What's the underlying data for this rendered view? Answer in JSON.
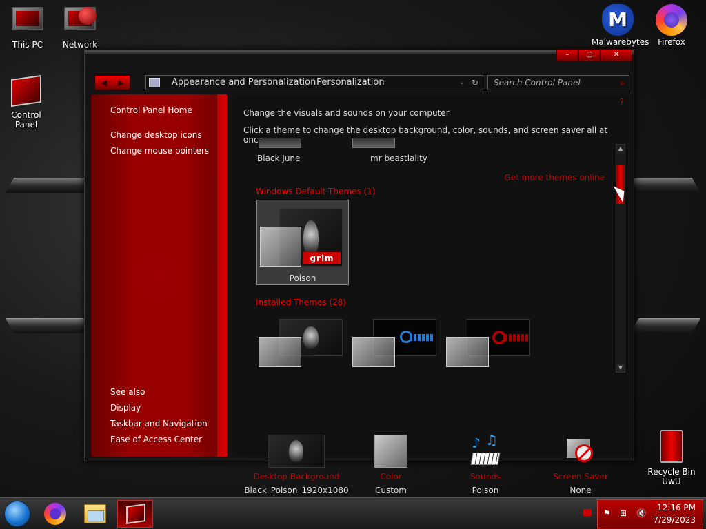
{
  "desktop": {
    "icons": [
      {
        "label": "This PC"
      },
      {
        "label": "Network"
      },
      {
        "label": "Control Panel"
      },
      {
        "label": "Malwarebytes"
      },
      {
        "label": "Firefox"
      },
      {
        "label": "Recycle Bin\nUwU"
      }
    ]
  },
  "window": {
    "caption": {
      "minimize": "–",
      "maximize": "□",
      "close": "✕"
    },
    "nav": {
      "back": "◀",
      "forward": "▶"
    },
    "address": {
      "crumbs": [
        "Appearance and Personalization",
        "Personalization"
      ],
      "dropdown": "⌄",
      "refresh": "↻"
    },
    "search": {
      "placeholder": "Search Control Panel",
      "icon": "⌕"
    },
    "sidebar": {
      "home": "Control Panel Home",
      "links": [
        "Change desktop icons",
        "Change mouse pointers"
      ],
      "see_also_header": "See also",
      "see_also": [
        "Display",
        "Taskbar and Navigation",
        "Ease of Access Center"
      ]
    },
    "content": {
      "title": "Change the visuals and sounds on your computer",
      "subtitle": "Click a theme to change the desktop background, color, sounds, and screen saver all at once.",
      "help": "?",
      "partial_themes": [
        "Black June",
        "mr beastiality"
      ],
      "get_more": "Get more themes online",
      "default_group": "Windows Default Themes (1)",
      "default_theme": {
        "name": "Poison",
        "badge": "grim",
        "selected": true
      },
      "installed_group": "Installed Themes (28)",
      "installed_thumbs": [
        "skull",
        "blue",
        "red"
      ],
      "bottom": [
        {
          "label": "Desktop Background",
          "value": "Black_Poison_1920x1080"
        },
        {
          "label": "Color",
          "value": "Custom"
        },
        {
          "label": "Sounds",
          "value": "Poison"
        },
        {
          "label": "Screen Saver",
          "value": "None"
        }
      ]
    },
    "scrollbar": {
      "position_fraction": 0.1
    }
  },
  "taskbar": {
    "pinned": [
      "Firefox",
      "File Explorer",
      "Control Panel"
    ],
    "active": "Control Panel",
    "clock": {
      "time": "12:16 PM",
      "date": "7/29/2023"
    }
  },
  "colors": {
    "accent": "#cc0000",
    "sidebar": "#980000",
    "window_bg": "#111111"
  }
}
